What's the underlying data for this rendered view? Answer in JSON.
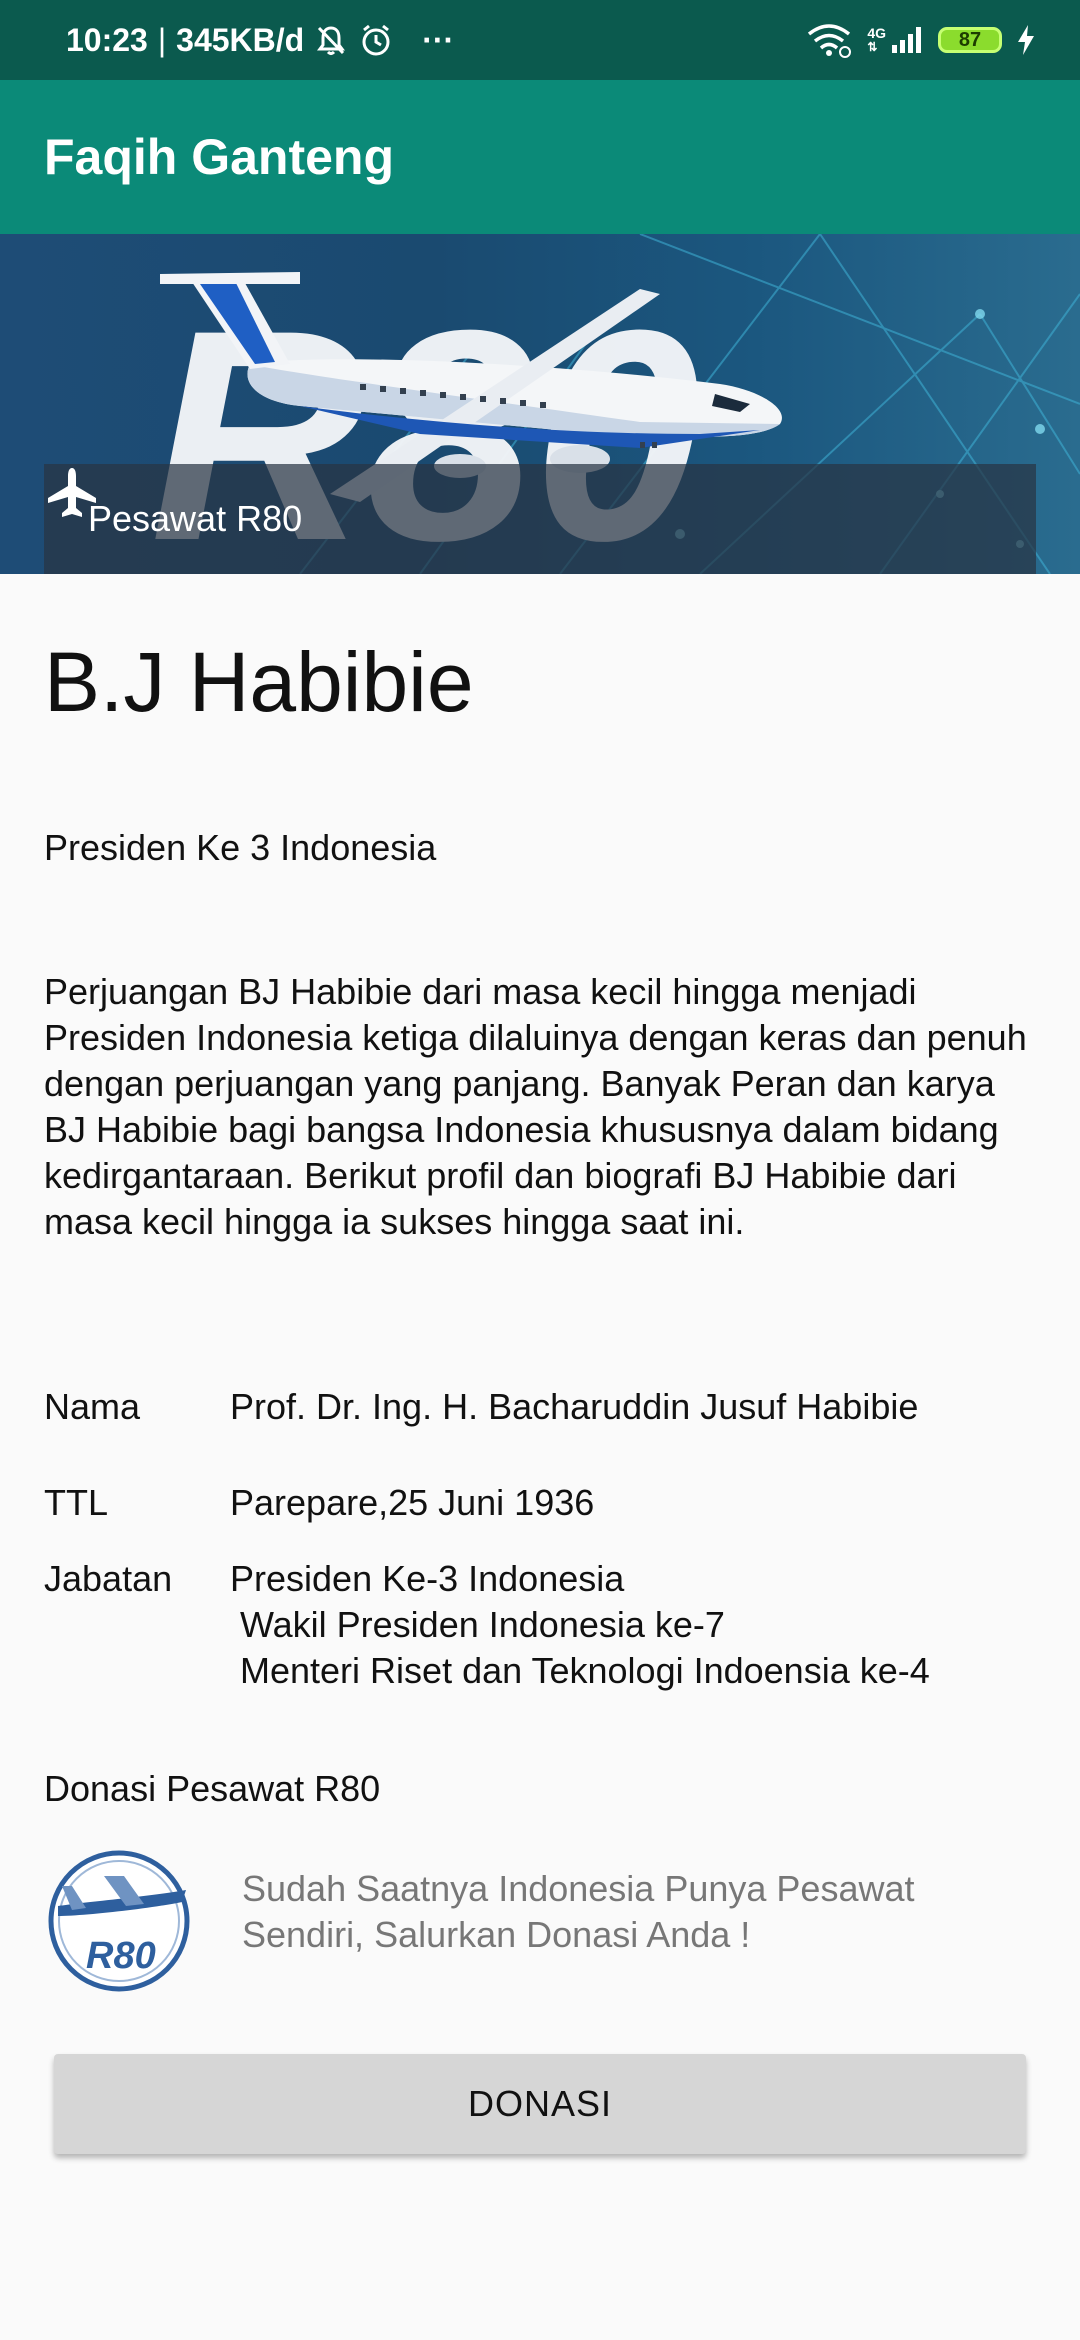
{
  "status_bar": {
    "time": "10:23",
    "network_speed": "345KB/d",
    "more": "···",
    "network_type": "4G",
    "battery_level": "87",
    "icons": [
      "muted-bell-icon",
      "alarm-clock-icon",
      "wifi-icon",
      "signal-icon",
      "battery-icon",
      "charging-icon"
    ]
  },
  "app_bar": {
    "title": "Faqih Ganteng"
  },
  "hero": {
    "image_lettering": "R80",
    "caption": "Pesawat R80",
    "caption_icon": "airplane-icon"
  },
  "profile": {
    "name": "B.J Habibie",
    "subtitle": "Presiden Ke 3 Indonesia",
    "bio": "Perjuangan BJ Habibie dari masa kecil hingga menjadi Presiden Indonesia ketiga dilaluinya dengan keras dan penuh dengan perjuangan yang panjang. Banyak Peran dan karya BJ Habibie bagi bangsa Indonesia khususnya dalam bidang kedirgantaraan. Berikut profil dan biografi BJ Habibie dari masa kecil hingga ia sukses hingga saat ini.",
    "details": {
      "nama_label": "Nama",
      "nama_value": "Prof. Dr. Ing. H. Bacharuddin Jusuf Habibie",
      "ttl_label": "TTL",
      "ttl_value": "Parepare,25 Juni 1936",
      "jabatan_label": "Jabatan",
      "jabatan_value": "Presiden Ke-3 Indonesia\n Wakil Presiden Indonesia ke-7\n Menteri Riset dan Teknologi Indoensia ke-4"
    }
  },
  "donation": {
    "title": "Donasi Pesawat R80",
    "logo_lettering": "R80",
    "message": "Sudah Saatnya Indonesia Punya Pesawat Sendiri, Salurkan Donasi Anda !",
    "button_label": "DONASI"
  },
  "colors": {
    "status_bar": "#0b5a4e",
    "app_bar": "#0b8a78",
    "background": "#fafafa",
    "button": "#d6d6d6",
    "muted_text": "#777777"
  }
}
